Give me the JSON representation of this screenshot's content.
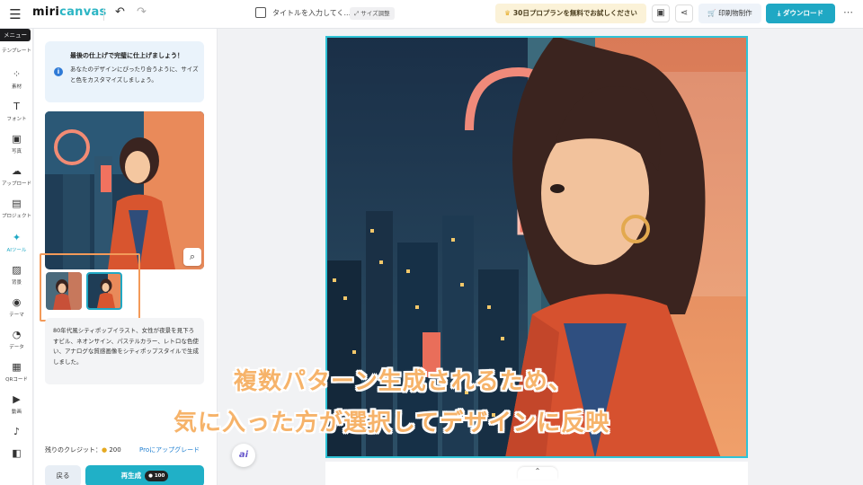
{
  "topbar": {
    "logo_a": "miri",
    "logo_b": "canvas",
    "title_placeholder": "タイトルを入力してく...",
    "resize_label": "サイズ調整",
    "promo_label": "30日プロプランを無料でお試しください",
    "print_label": "印刷物制作",
    "download_label": "ダウンロード"
  },
  "rail": {
    "tooltip": "メニュー",
    "items": [
      {
        "label": "テンプレート",
        "icon": "▭"
      },
      {
        "label": "素材",
        "icon": "⁘"
      },
      {
        "label": "フォント",
        "icon": "T"
      },
      {
        "label": "写真",
        "icon": "▣"
      },
      {
        "label": "アップロード",
        "icon": "☁"
      },
      {
        "label": "プロジェクト",
        "icon": "▤"
      },
      {
        "label": "AIツール",
        "icon": "✦"
      },
      {
        "label": "背景",
        "icon": "▨"
      },
      {
        "label": "テーマ",
        "icon": "◉"
      },
      {
        "label": "データ",
        "icon": "◔"
      },
      {
        "label": "QRコード",
        "icon": "▦"
      },
      {
        "label": "動画",
        "icon": "▶"
      },
      {
        "label": "",
        "icon": "♪"
      },
      {
        "label": "",
        "icon": "◧"
      }
    ]
  },
  "panel": {
    "info_title": "最後の仕上げで完璧に仕上げましょう！",
    "info_body": "あなたのデザインにぴったり合うように、サイズと色をカスタマイズしましょう。",
    "prompt": "80年代風シティポップイラスト、女性が夜景を見下ろすビル、ネオンサイン、パステルカラー、レトロな色使い、アナログな質感画像をシティポップスタイルで生成しました。",
    "credits_label": "残りのクレジット：",
    "credits_value": "200",
    "upgrade_label": "Proにアップグレード",
    "back_label": "戻る",
    "regen_label": "再生成",
    "regen_cost": "100"
  },
  "caption": {
    "line1": "複数パターン生成されるため、",
    "line2": "気に入った方が選択してデザインに反映"
  },
  "colors": {
    "accent": "#1fa8c4",
    "highlight": "#f39a59",
    "caption": "#f6b36a"
  }
}
